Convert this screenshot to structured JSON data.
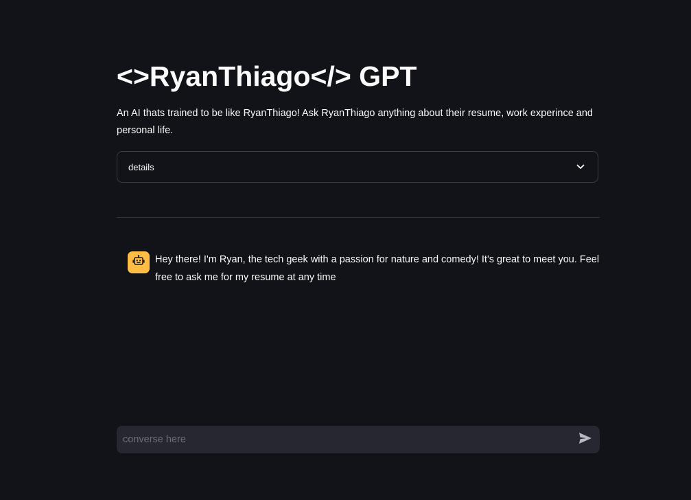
{
  "header": {
    "title": "<>RyanThiago</> GPT",
    "description": "An AI thats trained to be like RyanThiago! Ask RyanThiago anything about their resume, work experince and personal life."
  },
  "expander": {
    "label": "details",
    "icon": "chevron-down-icon"
  },
  "chat": {
    "messages": [
      {
        "role": "assistant",
        "avatar_icon": "robot-icon",
        "avatar_color": "#ffbd45",
        "text": "Hey there! I'm Ryan, the tech geek with a passion for nature and comedy! It's great to meet you. Feel free to ask me for my resume at any time"
      }
    ],
    "input": {
      "placeholder": "converse here",
      "value": "",
      "send_icon": "send-icon"
    }
  },
  "colors": {
    "background": "#111318",
    "input_background": "#262730",
    "border": "#3a3d46",
    "accent": "#ffbd45"
  }
}
